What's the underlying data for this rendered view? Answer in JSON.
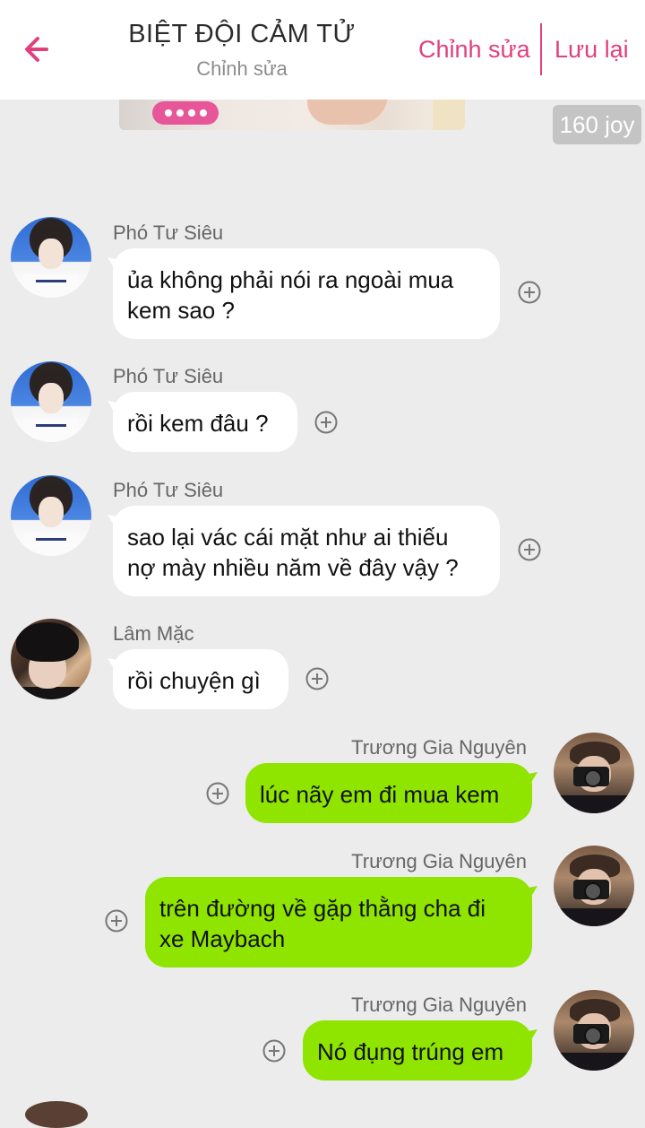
{
  "header": {
    "title": "BIỆT ĐỘI CẢM TỬ",
    "subtitle": "Chỉnh sửa",
    "edit_label": "Chỉnh sửa",
    "save_label": "Lưu lại",
    "back_icon": "arrow-left-icon",
    "accent": "#e0407e"
  },
  "top_badge": {
    "joy": "160 joy"
  },
  "messages": [
    {
      "sender": "Phó Tư Siêu",
      "side": "left",
      "text": "ủa không phải nói ra ngoài mua kem sao ?"
    },
    {
      "sender": "Phó Tư Siêu",
      "side": "left",
      "text": "rồi kem đâu ?"
    },
    {
      "sender": "Phó Tư Siêu",
      "side": "left",
      "text": "sao lại vác cái mặt như ai thiếu nợ mày nhiều năm về đây vậy ?"
    },
    {
      "sender": "Lâm Mặc",
      "side": "left",
      "text": "rồi chuyện gì"
    },
    {
      "sender": "Trương Gia Nguyên",
      "side": "right",
      "text": "lúc nãy em đi mua kem"
    },
    {
      "sender": "Trương Gia Nguyên",
      "side": "right",
      "text": "trên đường về gặp thằng cha đi xe Maybach"
    },
    {
      "sender": "Trương Gia Nguyên",
      "side": "right",
      "text": "Nó đụng trúng em"
    }
  ],
  "colors": {
    "left_bubble": "#ffffff",
    "right_bubble": "#8fe400",
    "background": "#ececec"
  }
}
